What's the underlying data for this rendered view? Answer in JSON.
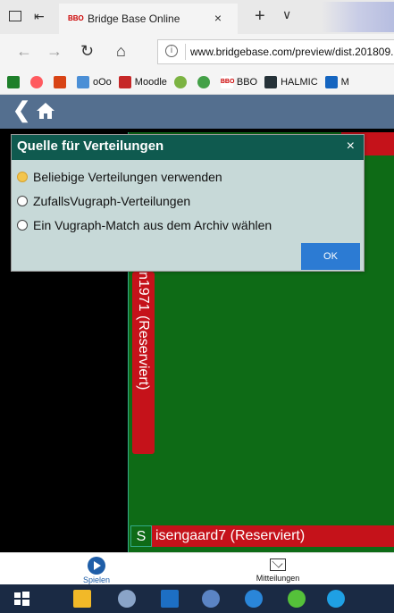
{
  "browser": {
    "tab_title": "Bridge Base Online",
    "tab_favicon": "BBO",
    "tab_close": "×",
    "new_tab": "+",
    "tab_list": "∨",
    "url": "www.bridgebase.com/preview/dist.201809...",
    "favorites": [
      {
        "label": "",
        "icon": "x-icon",
        "color": "#1e7f2a"
      },
      {
        "label": "",
        "icon": "airbnb-icon",
        "color": "#ff5a5f"
      },
      {
        "label": "",
        "icon": "app-icon",
        "color": "#d84315"
      },
      {
        "label": "oOo",
        "icon": "folder-icon",
        "color": "#4b8fd6"
      },
      {
        "label": "Moodle",
        "icon": "moodle-icon",
        "color": "#c62828"
      },
      {
        "label": "",
        "icon": "u-icon",
        "color": "#7cb342"
      },
      {
        "label": "",
        "icon": "id-icon",
        "color": "#43a047"
      },
      {
        "label": "BBO",
        "icon": "bbo-icon",
        "color": "#c00000"
      },
      {
        "label": "HALMIC",
        "icon": "halmic-icon",
        "color": "#263238"
      },
      {
        "label": "M",
        "icon": "m-icon",
        "color": "#1565c0"
      }
    ]
  },
  "dialog": {
    "title": "Quelle für Verteilungen",
    "close": "×",
    "options": [
      {
        "label": "Beliebige Verteilungen verwenden",
        "selected": true
      },
      {
        "label": "ZufallsVugraph-Verteilungen",
        "selected": false
      },
      {
        "label": "Ein Vugraph-Match aus dem Archiv wählen",
        "selected": false
      }
    ],
    "ok": "OK"
  },
  "table": {
    "west_player": "n1971 (Reserviert)",
    "south_seat": "S",
    "south_player": "isengaard7 (Reserviert)"
  },
  "bottom_tabs": {
    "play": "Spielen",
    "messages": "Mitteilungen"
  },
  "colors": {
    "header": "#546f8f",
    "felt": "#0e6b16",
    "seat_red": "#c5121a",
    "dialog_head": "#0f5a4f",
    "dialog_body": "#c7d9d8",
    "ok_button": "#2c7bd3"
  }
}
